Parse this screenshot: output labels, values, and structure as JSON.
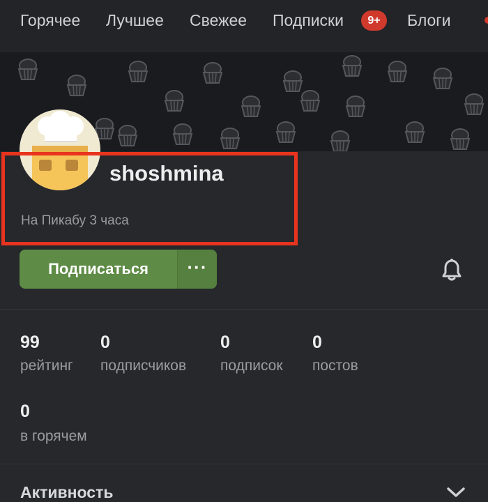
{
  "nav": {
    "items": [
      {
        "label": "Горячее"
      },
      {
        "label": "Лучшее"
      },
      {
        "label": "Свежее"
      },
      {
        "label": "Подписки"
      },
      {
        "label": "Блоги"
      }
    ],
    "subs_badge": "9+"
  },
  "banner": {
    "pattern_icon": "cupcake-icon"
  },
  "profile": {
    "avatar_icon": "chef-avatar-icon",
    "username": "shoshmina",
    "joined": "На Пикабу 3 часа"
  },
  "actions": {
    "subscribe_label": "Подписаться",
    "more_label": "···",
    "bell_icon": "bell-icon"
  },
  "stats": [
    {
      "value": "99",
      "label": "рейтинг"
    },
    {
      "value": "0",
      "label": "подписчиков"
    },
    {
      "value": "0",
      "label": "подписок"
    },
    {
      "value": "0",
      "label": "постов"
    },
    {
      "value": "0",
      "label": "в горячем"
    }
  ],
  "activity": {
    "label": "Активность",
    "icon": "chevron-down-icon"
  },
  "colors": {
    "background": "#26282c",
    "subscribe": "#5e8b45",
    "badge": "#d03a2d",
    "highlight": "#e8341f"
  }
}
